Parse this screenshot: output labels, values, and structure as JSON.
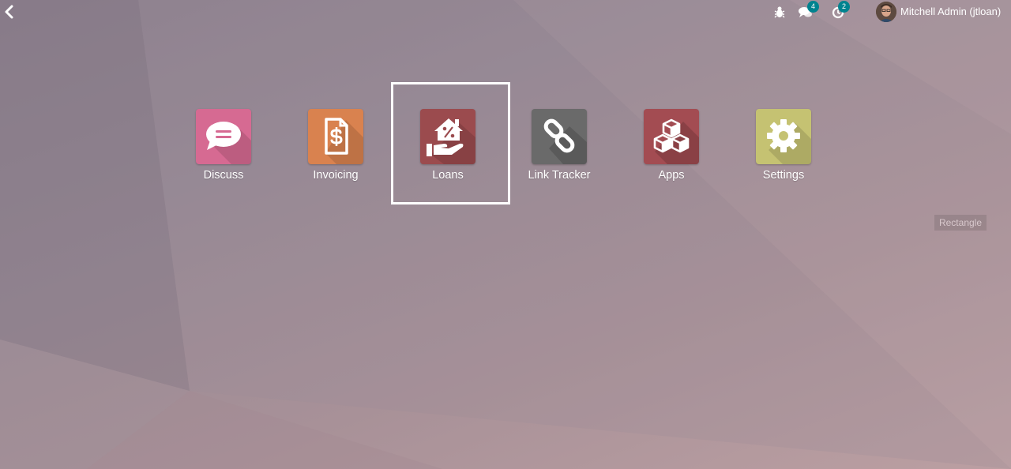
{
  "systray": {
    "debug_icon": "bug-icon",
    "messages_count": "4",
    "activities_count": "2"
  },
  "user": {
    "name": "Mitchell Admin (jtloan)"
  },
  "apps": [
    {
      "label": "Discuss",
      "color": "#d66a92",
      "icon": "chat-bubble-icon"
    },
    {
      "label": "Invoicing",
      "color": "#d9824f",
      "icon": "invoice-dollar-icon"
    },
    {
      "label": "Loans",
      "color": "#9b4b4e",
      "icon": "house-percent-hand-icon"
    },
    {
      "label": "Link Tracker",
      "color": "#6a6a6a",
      "icon": "chain-link-icon"
    },
    {
      "label": "Apps",
      "color": "#a34c52",
      "icon": "cubes-icon"
    },
    {
      "label": "Settings",
      "color": "#c5c272",
      "icon": "gear-icon"
    }
  ],
  "annotation": {
    "tag": "Rectangle"
  },
  "colors": {
    "badge": "#00838f",
    "highlight": "#ffffff"
  }
}
